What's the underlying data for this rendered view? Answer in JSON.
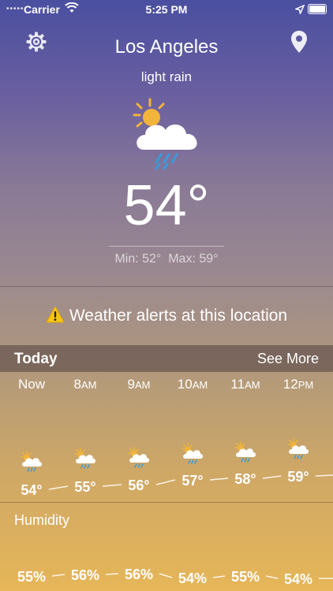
{
  "status_bar": {
    "signal": "•••••",
    "carrier": "Carrier",
    "time": "5:25 PM"
  },
  "location": {
    "city": "Los Angeles",
    "condition": "light rain"
  },
  "current": {
    "temp": "54°",
    "min_label": "Min: 52°",
    "max_label": "Max: 59°",
    "icon": "sun-cloud-rain-icon"
  },
  "alert": {
    "text": "Weather alerts at this location",
    "icon": "warning-icon"
  },
  "today": {
    "title": "Today",
    "see_more": "See More"
  },
  "hourly": [
    {
      "hour": "Now",
      "suffix": "",
      "temp": "54°",
      "icon": "sun-cloud-rain-icon"
    },
    {
      "hour": "8",
      "suffix": "AM",
      "temp": "55°",
      "icon": "sun-cloud-rain-icon"
    },
    {
      "hour": "9",
      "suffix": "AM",
      "temp": "56°",
      "icon": "sun-cloud-rain-icon"
    },
    {
      "hour": "10",
      "suffix": "AM",
      "temp": "57°",
      "icon": "sun-cloud-rain-icon"
    },
    {
      "hour": "11",
      "suffix": "AM",
      "temp": "58°",
      "icon": "sun-cloud-rain-icon"
    },
    {
      "hour": "12",
      "suffix": "PM",
      "temp": "59°",
      "icon": "sun-cloud-rain-icon"
    }
  ],
  "humidity": {
    "label": "Humidity",
    "values": [
      "55%",
      "56%",
      "56%",
      "54%",
      "55%",
      "54%"
    ]
  }
}
